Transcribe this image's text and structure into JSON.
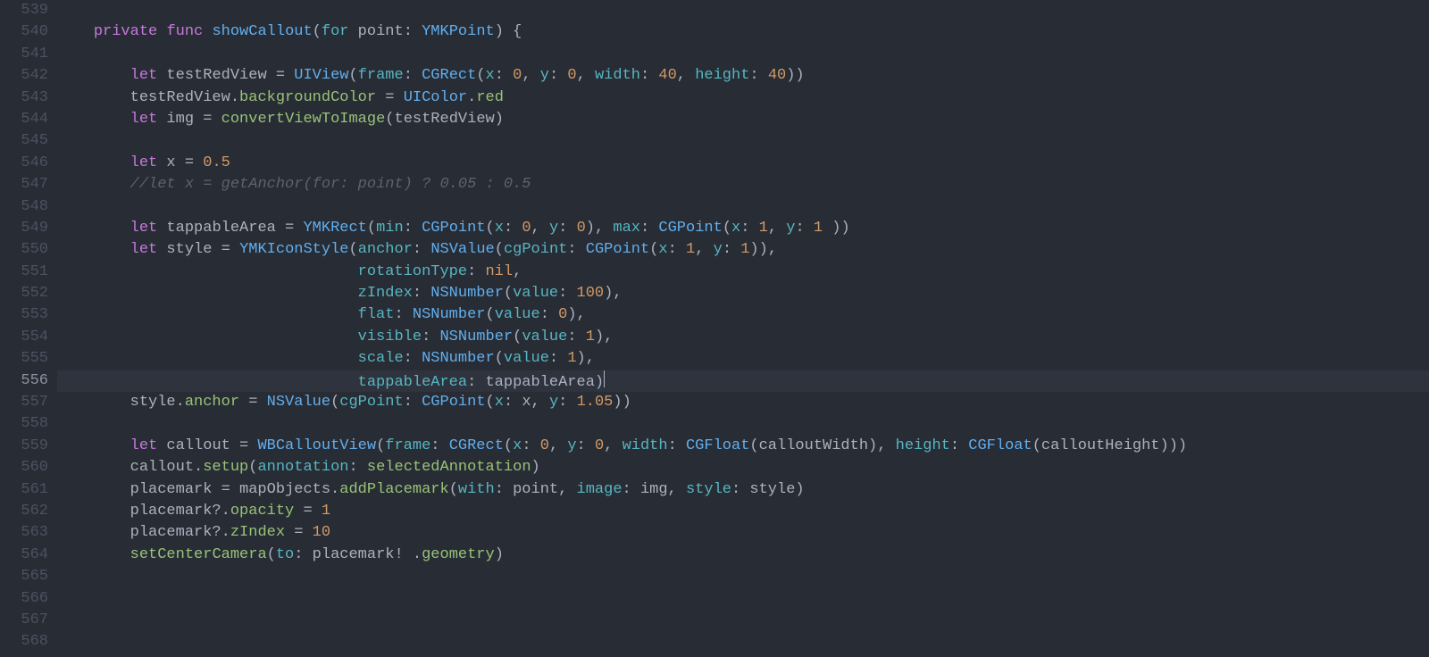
{
  "editor": {
    "first_line": 539,
    "current_line": 556,
    "lines": [
      {
        "n": 539,
        "tokens": []
      },
      {
        "n": 540,
        "tokens": [
          {
            "t": "    ",
            "c": "p"
          },
          {
            "t": "private",
            "c": "kw"
          },
          {
            "t": " ",
            "c": "p"
          },
          {
            "t": "func",
            "c": "kw"
          },
          {
            "t": " ",
            "c": "p"
          },
          {
            "t": "showCallout",
            "c": "ty"
          },
          {
            "t": "(",
            "c": "p"
          },
          {
            "t": "for",
            "c": "pr"
          },
          {
            "t": " point: ",
            "c": "id"
          },
          {
            "t": "YMKPoint",
            "c": "ty"
          },
          {
            "t": ") {",
            "c": "p"
          }
        ]
      },
      {
        "n": 541,
        "tokens": []
      },
      {
        "n": 542,
        "tokens": [
          {
            "t": "        ",
            "c": "p"
          },
          {
            "t": "let",
            "c": "kw"
          },
          {
            "t": " testRedView = ",
            "c": "id"
          },
          {
            "t": "UIView",
            "c": "ty"
          },
          {
            "t": "(",
            "c": "p"
          },
          {
            "t": "frame",
            "c": "pr"
          },
          {
            "t": ": ",
            "c": "p"
          },
          {
            "t": "CGRect",
            "c": "ty"
          },
          {
            "t": "(",
            "c": "p"
          },
          {
            "t": "x",
            "c": "pr"
          },
          {
            "t": ": ",
            "c": "p"
          },
          {
            "t": "0",
            "c": "num"
          },
          {
            "t": ", ",
            "c": "p"
          },
          {
            "t": "y",
            "c": "pr"
          },
          {
            "t": ": ",
            "c": "p"
          },
          {
            "t": "0",
            "c": "num"
          },
          {
            "t": ", ",
            "c": "p"
          },
          {
            "t": "width",
            "c": "pr"
          },
          {
            "t": ": ",
            "c": "p"
          },
          {
            "t": "40",
            "c": "num"
          },
          {
            "t": ", ",
            "c": "p"
          },
          {
            "t": "height",
            "c": "pr"
          },
          {
            "t": ": ",
            "c": "p"
          },
          {
            "t": "40",
            "c": "num"
          },
          {
            "t": "))",
            "c": "p"
          }
        ]
      },
      {
        "n": 543,
        "tokens": [
          {
            "t": "        testRedView.",
            "c": "id"
          },
          {
            "t": "backgroundColor",
            "c": "fn"
          },
          {
            "t": " = ",
            "c": "p"
          },
          {
            "t": "UIColor",
            "c": "ty"
          },
          {
            "t": ".",
            "c": "p"
          },
          {
            "t": "red",
            "c": "fn"
          }
        ]
      },
      {
        "n": 544,
        "tokens": [
          {
            "t": "        ",
            "c": "p"
          },
          {
            "t": "let",
            "c": "kw"
          },
          {
            "t": " img = ",
            "c": "id"
          },
          {
            "t": "convertViewToImage",
            "c": "fn"
          },
          {
            "t": "(testRedView)",
            "c": "id"
          }
        ]
      },
      {
        "n": 545,
        "tokens": []
      },
      {
        "n": 546,
        "tokens": [
          {
            "t": "        ",
            "c": "p"
          },
          {
            "t": "let",
            "c": "kw"
          },
          {
            "t": " x = ",
            "c": "id"
          },
          {
            "t": "0.5",
            "c": "num"
          }
        ]
      },
      {
        "n": 547,
        "tokens": [
          {
            "t": "        ",
            "c": "p"
          },
          {
            "t": "//let x = getAnchor(for: point) ? 0.05 : 0.5",
            "c": "cmt"
          }
        ]
      },
      {
        "n": 548,
        "tokens": []
      },
      {
        "n": 549,
        "tokens": [
          {
            "t": "        ",
            "c": "p"
          },
          {
            "t": "let",
            "c": "kw"
          },
          {
            "t": " tappableArea = ",
            "c": "id"
          },
          {
            "t": "YMKRect",
            "c": "ty"
          },
          {
            "t": "(",
            "c": "p"
          },
          {
            "t": "min",
            "c": "pr"
          },
          {
            "t": ": ",
            "c": "p"
          },
          {
            "t": "CGPoint",
            "c": "ty"
          },
          {
            "t": "(",
            "c": "p"
          },
          {
            "t": "x",
            "c": "pr"
          },
          {
            "t": ": ",
            "c": "p"
          },
          {
            "t": "0",
            "c": "num"
          },
          {
            "t": ", ",
            "c": "p"
          },
          {
            "t": "y",
            "c": "pr"
          },
          {
            "t": ": ",
            "c": "p"
          },
          {
            "t": "0",
            "c": "num"
          },
          {
            "t": "), ",
            "c": "p"
          },
          {
            "t": "max",
            "c": "pr"
          },
          {
            "t": ": ",
            "c": "p"
          },
          {
            "t": "CGPoint",
            "c": "ty"
          },
          {
            "t": "(",
            "c": "p"
          },
          {
            "t": "x",
            "c": "pr"
          },
          {
            "t": ": ",
            "c": "p"
          },
          {
            "t": "1",
            "c": "num"
          },
          {
            "t": ", ",
            "c": "p"
          },
          {
            "t": "y",
            "c": "pr"
          },
          {
            "t": ": ",
            "c": "p"
          },
          {
            "t": "1",
            "c": "num"
          },
          {
            "t": " ))",
            "c": "p"
          }
        ]
      },
      {
        "n": 550,
        "tokens": [
          {
            "t": "        ",
            "c": "p"
          },
          {
            "t": "let",
            "c": "kw"
          },
          {
            "t": " style = ",
            "c": "id"
          },
          {
            "t": "YMKIconStyle",
            "c": "ty"
          },
          {
            "t": "(",
            "c": "p"
          },
          {
            "t": "anchor",
            "c": "pr"
          },
          {
            "t": ": ",
            "c": "p"
          },
          {
            "t": "NSValue",
            "c": "ty"
          },
          {
            "t": "(",
            "c": "p"
          },
          {
            "t": "cgPoint",
            "c": "pr"
          },
          {
            "t": ": ",
            "c": "p"
          },
          {
            "t": "CGPoint",
            "c": "ty"
          },
          {
            "t": "(",
            "c": "p"
          },
          {
            "t": "x",
            "c": "pr"
          },
          {
            "t": ": ",
            "c": "p"
          },
          {
            "t": "1",
            "c": "num"
          },
          {
            "t": ", ",
            "c": "p"
          },
          {
            "t": "y",
            "c": "pr"
          },
          {
            "t": ": ",
            "c": "p"
          },
          {
            "t": "1",
            "c": "num"
          },
          {
            "t": ")),",
            "c": "p"
          }
        ]
      },
      {
        "n": 551,
        "tokens": [
          {
            "t": "                                 ",
            "c": "p"
          },
          {
            "t": "rotationType",
            "c": "pr"
          },
          {
            "t": ": ",
            "c": "p"
          },
          {
            "t": "nil",
            "c": "num"
          },
          {
            "t": ",",
            "c": "p"
          }
        ]
      },
      {
        "n": 552,
        "tokens": [
          {
            "t": "                                 ",
            "c": "p"
          },
          {
            "t": "zIndex",
            "c": "pr"
          },
          {
            "t": ": ",
            "c": "p"
          },
          {
            "t": "NSNumber",
            "c": "ty"
          },
          {
            "t": "(",
            "c": "p"
          },
          {
            "t": "value",
            "c": "pr"
          },
          {
            "t": ": ",
            "c": "p"
          },
          {
            "t": "100",
            "c": "num"
          },
          {
            "t": "),",
            "c": "p"
          }
        ]
      },
      {
        "n": 553,
        "tokens": [
          {
            "t": "                                 ",
            "c": "p"
          },
          {
            "t": "flat",
            "c": "pr"
          },
          {
            "t": ": ",
            "c": "p"
          },
          {
            "t": "NSNumber",
            "c": "ty"
          },
          {
            "t": "(",
            "c": "p"
          },
          {
            "t": "value",
            "c": "pr"
          },
          {
            "t": ": ",
            "c": "p"
          },
          {
            "t": "0",
            "c": "num"
          },
          {
            "t": "),",
            "c": "p"
          }
        ]
      },
      {
        "n": 554,
        "tokens": [
          {
            "t": "                                 ",
            "c": "p"
          },
          {
            "t": "visible",
            "c": "pr"
          },
          {
            "t": ": ",
            "c": "p"
          },
          {
            "t": "NSNumber",
            "c": "ty"
          },
          {
            "t": "(",
            "c": "p"
          },
          {
            "t": "value",
            "c": "pr"
          },
          {
            "t": ": ",
            "c": "p"
          },
          {
            "t": "1",
            "c": "num"
          },
          {
            "t": "),",
            "c": "p"
          }
        ]
      },
      {
        "n": 555,
        "tokens": [
          {
            "t": "                                 ",
            "c": "p"
          },
          {
            "t": "scale",
            "c": "pr"
          },
          {
            "t": ": ",
            "c": "p"
          },
          {
            "t": "NSNumber",
            "c": "ty"
          },
          {
            "t": "(",
            "c": "p"
          },
          {
            "t": "value",
            "c": "pr"
          },
          {
            "t": ": ",
            "c": "p"
          },
          {
            "t": "1",
            "c": "num"
          },
          {
            "t": "),",
            "c": "p"
          }
        ]
      },
      {
        "n": 556,
        "hl": true,
        "tokens": [
          {
            "t": "                                 ",
            "c": "p"
          },
          {
            "t": "tappableArea",
            "c": "pr"
          },
          {
            "t": ": tappableArea)",
            "c": "id"
          },
          {
            "t": "CURSOR",
            "c": "cursor"
          }
        ]
      },
      {
        "n": 557,
        "tokens": [
          {
            "t": "        style.",
            "c": "id"
          },
          {
            "t": "anchor",
            "c": "fn"
          },
          {
            "t": " = ",
            "c": "p"
          },
          {
            "t": "NSValue",
            "c": "ty"
          },
          {
            "t": "(",
            "c": "p"
          },
          {
            "t": "cgPoint",
            "c": "pr"
          },
          {
            "t": ": ",
            "c": "p"
          },
          {
            "t": "CGPoint",
            "c": "ty"
          },
          {
            "t": "(",
            "c": "p"
          },
          {
            "t": "x",
            "c": "pr"
          },
          {
            "t": ": x, ",
            "c": "id"
          },
          {
            "t": "y",
            "c": "pr"
          },
          {
            "t": ": ",
            "c": "p"
          },
          {
            "t": "1.05",
            "c": "num"
          },
          {
            "t": "))",
            "c": "p"
          }
        ]
      },
      {
        "n": 558,
        "tokens": []
      },
      {
        "n": 559,
        "tokens": [
          {
            "t": "        ",
            "c": "p"
          },
          {
            "t": "let",
            "c": "kw"
          },
          {
            "t": " callout = ",
            "c": "id"
          },
          {
            "t": "WBCalloutView",
            "c": "ty"
          },
          {
            "t": "(",
            "c": "p"
          },
          {
            "t": "frame",
            "c": "pr"
          },
          {
            "t": ": ",
            "c": "p"
          },
          {
            "t": "CGRect",
            "c": "ty"
          },
          {
            "t": "(",
            "c": "p"
          },
          {
            "t": "x",
            "c": "pr"
          },
          {
            "t": ": ",
            "c": "p"
          },
          {
            "t": "0",
            "c": "num"
          },
          {
            "t": ", ",
            "c": "p"
          },
          {
            "t": "y",
            "c": "pr"
          },
          {
            "t": ": ",
            "c": "p"
          },
          {
            "t": "0",
            "c": "num"
          },
          {
            "t": ", ",
            "c": "p"
          },
          {
            "t": "width",
            "c": "pr"
          },
          {
            "t": ": ",
            "c": "p"
          },
          {
            "t": "CGFloat",
            "c": "ty"
          },
          {
            "t": "(calloutWidth), ",
            "c": "id"
          },
          {
            "t": "height",
            "c": "pr"
          },
          {
            "t": ": ",
            "c": "p"
          },
          {
            "t": "CGFloat",
            "c": "ty"
          },
          {
            "t": "(calloutHeight)))",
            "c": "id"
          }
        ]
      },
      {
        "n": 560,
        "tokens": [
          {
            "t": "        callout.",
            "c": "id"
          },
          {
            "t": "setup",
            "c": "fn"
          },
          {
            "t": "(",
            "c": "p"
          },
          {
            "t": "annotation",
            "c": "pr"
          },
          {
            "t": ": ",
            "c": "p"
          },
          {
            "t": "selectedAnnotation",
            "c": "fn"
          },
          {
            "t": ")",
            "c": "p"
          }
        ]
      },
      {
        "n": 561,
        "tokens": [
          {
            "t": "        placemark = mapObjects.",
            "c": "id"
          },
          {
            "t": "addPlacemark",
            "c": "fn"
          },
          {
            "t": "(",
            "c": "p"
          },
          {
            "t": "with",
            "c": "pr"
          },
          {
            "t": ": point, ",
            "c": "id"
          },
          {
            "t": "image",
            "c": "pr"
          },
          {
            "t": ": img, ",
            "c": "id"
          },
          {
            "t": "style",
            "c": "pr"
          },
          {
            "t": ": style)",
            "c": "id"
          }
        ]
      },
      {
        "n": 562,
        "tokens": [
          {
            "t": "        placemark?.",
            "c": "id"
          },
          {
            "t": "opacity",
            "c": "fn"
          },
          {
            "t": " = ",
            "c": "p"
          },
          {
            "t": "1",
            "c": "num"
          }
        ]
      },
      {
        "n": 563,
        "tokens": [
          {
            "t": "        placemark?.",
            "c": "id"
          },
          {
            "t": "zIndex",
            "c": "fn"
          },
          {
            "t": " = ",
            "c": "p"
          },
          {
            "t": "10",
            "c": "num"
          }
        ]
      },
      {
        "n": 564,
        "tokens": [
          {
            "t": "        ",
            "c": "p"
          },
          {
            "t": "setCenterCamera",
            "c": "fn"
          },
          {
            "t": "(",
            "c": "p"
          },
          {
            "t": "to",
            "c": "pr"
          },
          {
            "t": ": placemark! .",
            "c": "id"
          },
          {
            "t": "geometry",
            "c": "fn"
          },
          {
            "t": ")",
            "c": "p"
          }
        ]
      },
      {
        "n": 565,
        "tokens": []
      },
      {
        "n": 566,
        "tokens": []
      },
      {
        "n": 567,
        "tokens": []
      },
      {
        "n": 568,
        "tokens": []
      }
    ]
  }
}
